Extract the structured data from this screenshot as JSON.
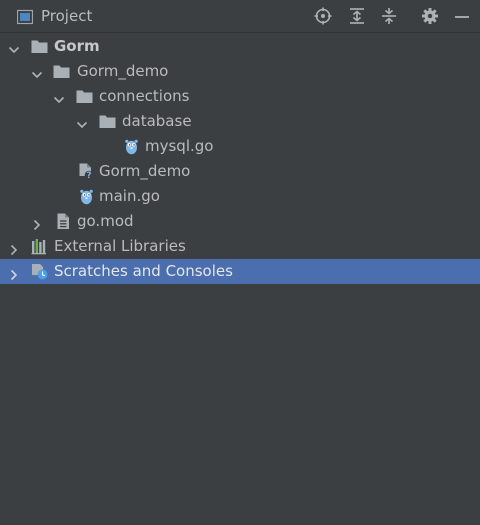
{
  "header": {
    "title": "Project",
    "tools": [
      "locate-icon",
      "expand-all-icon",
      "collapse-all-icon",
      "gear-icon",
      "minimize-icon"
    ]
  },
  "tree": {
    "items": [
      {
        "label": "Gorm",
        "icon": "folder-icon",
        "expanded": true,
        "bold": true
      },
      {
        "label": "Gorm_demo",
        "icon": "folder-icon",
        "expanded": true
      },
      {
        "label": "connections",
        "icon": "folder-icon",
        "expanded": true
      },
      {
        "label": "database",
        "icon": "folder-icon",
        "expanded": true
      },
      {
        "label": "mysql.go",
        "icon": "go-file-icon"
      },
      {
        "label": "Gorm_demo",
        "icon": "unknown-file-icon"
      },
      {
        "label": "main.go",
        "icon": "go-file-icon"
      },
      {
        "label": "go.mod",
        "icon": "go-mod-file-icon",
        "expanded": false
      },
      {
        "label": "External Libraries",
        "icon": "libraries-icon",
        "expanded": false
      },
      {
        "label": "Scratches and Consoles",
        "icon": "scratches-icon",
        "expanded": false,
        "selected": true
      }
    ]
  },
  "colors": {
    "background": "#3c3f41",
    "selection": "#4b6eaf",
    "text": "#bbbbbb",
    "folder": "#a9b0b6",
    "gopher": "#7fb7e8"
  }
}
